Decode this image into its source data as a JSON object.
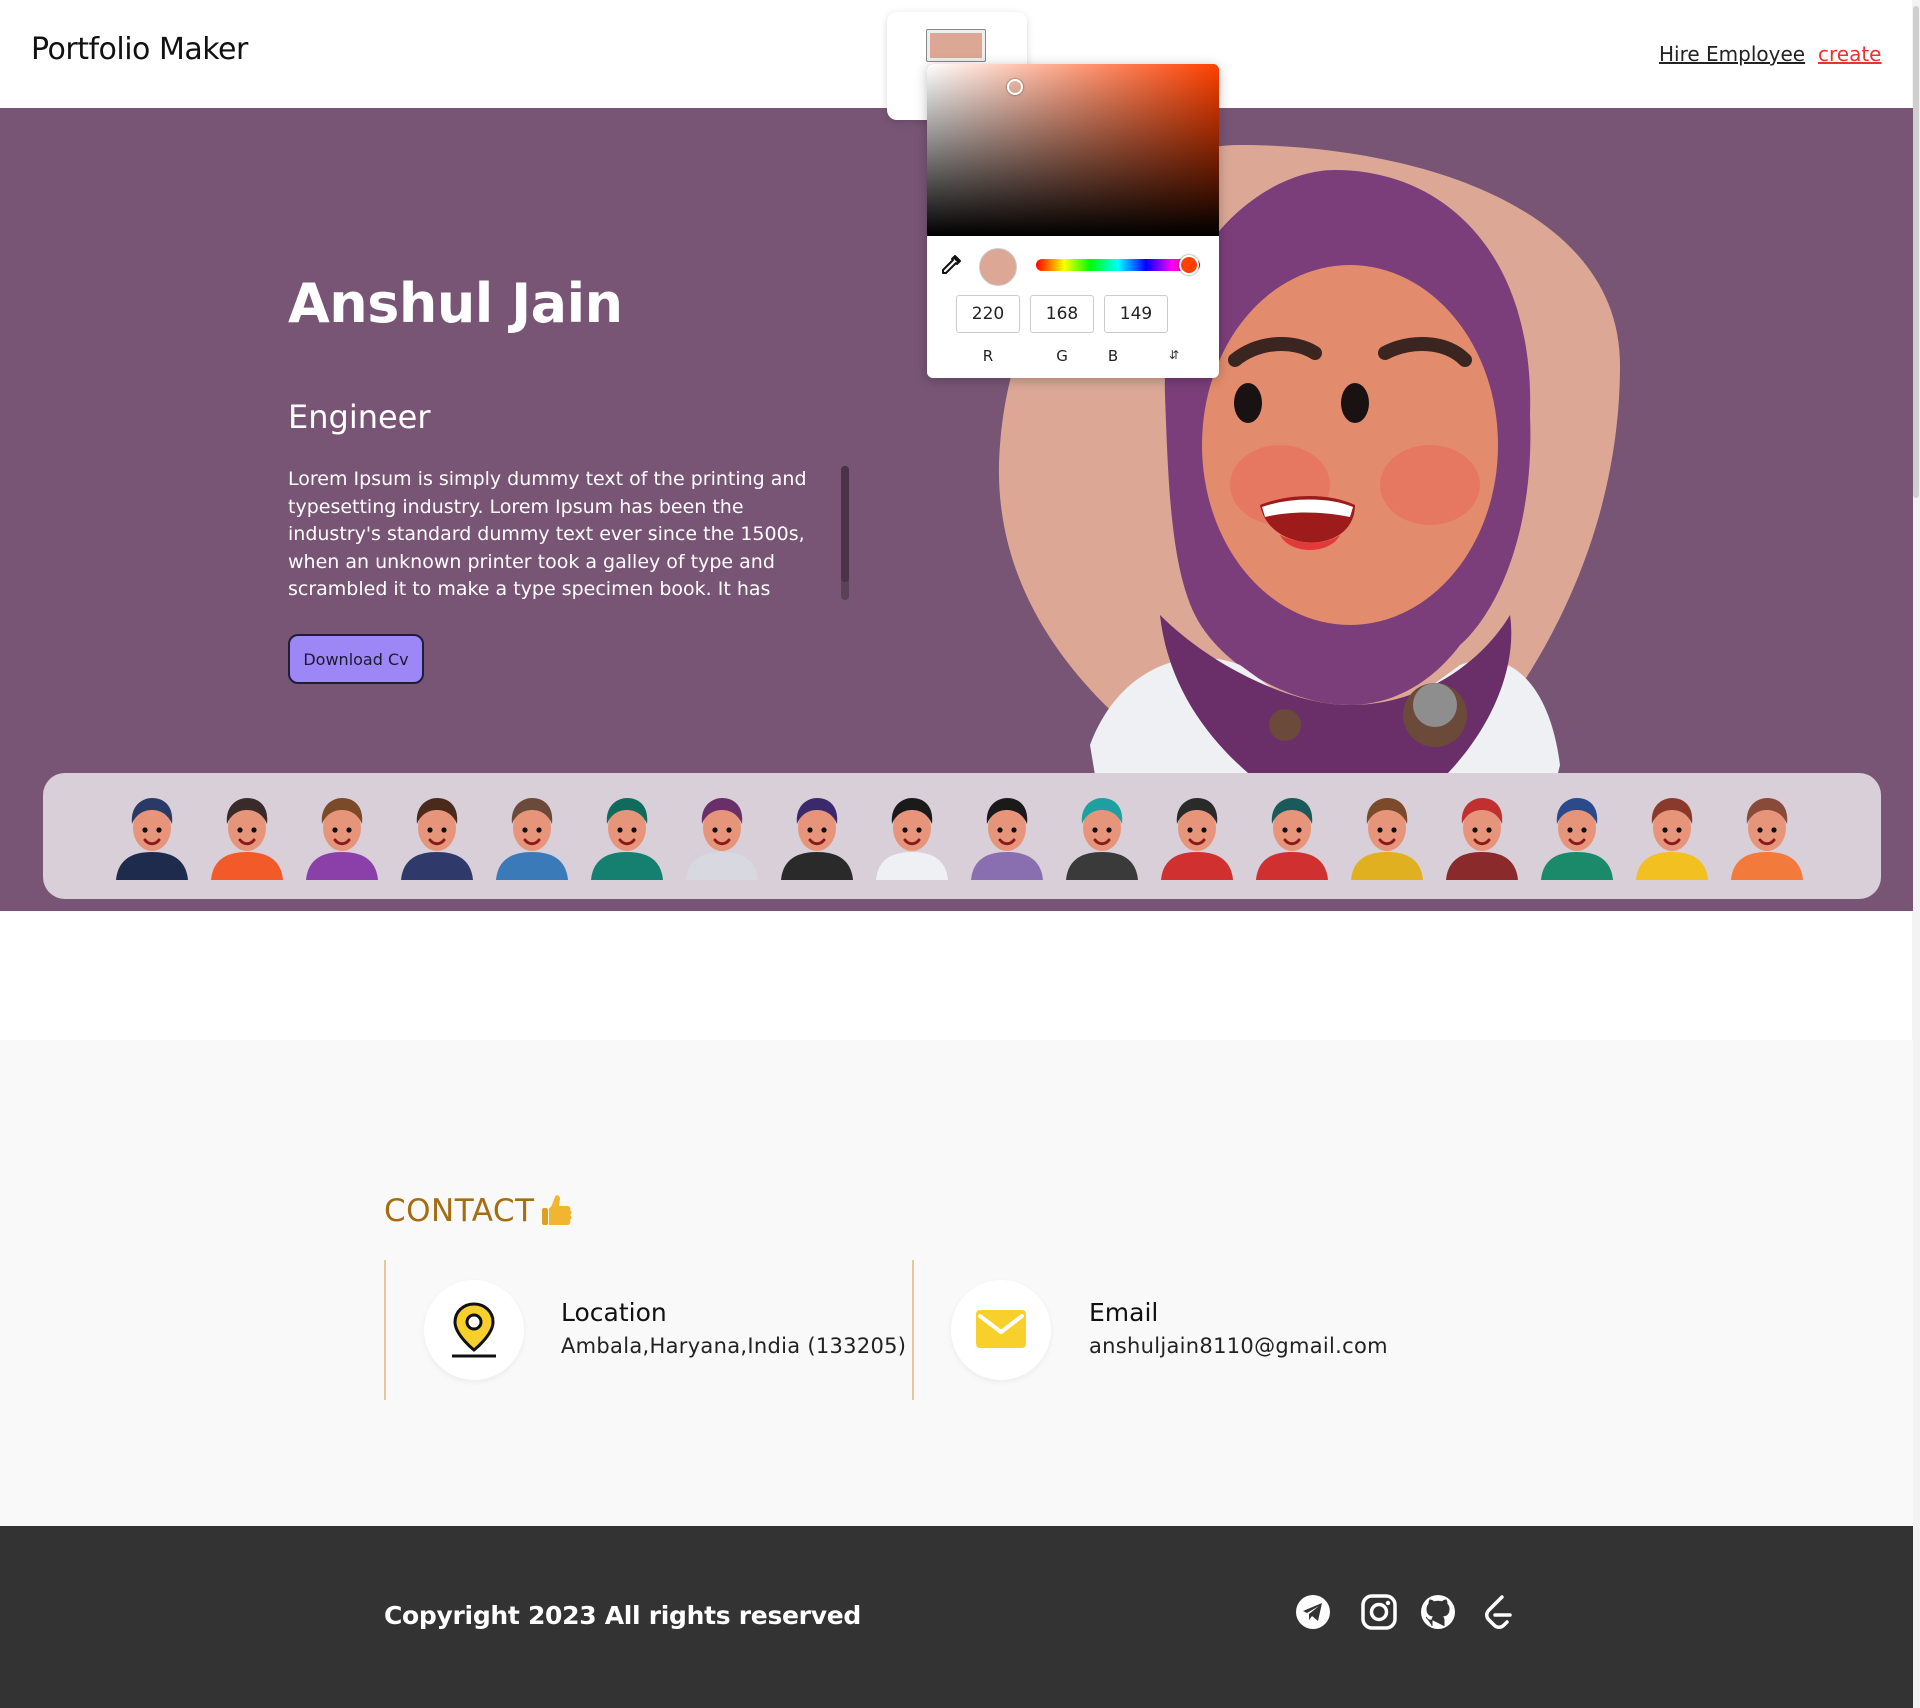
{
  "header": {
    "brand": "Portfolio Maker",
    "nav": {
      "hire": "Hire Employee",
      "create": "create"
    }
  },
  "hero": {
    "name": "Anshul Jain",
    "role": "Engineer",
    "description": "Lorem Ipsum is simply dummy text of the printing and typesetting industry. Lorem Ipsum has been the industry's standard dummy text ever since the 1500s, when an unknown printer took a galley of type and scrambled it to make a type specimen book. It has survived not only five",
    "download_button": "Download Cv",
    "background_color": "#785575",
    "blob_color": "#dca895"
  },
  "avatar_strip": {
    "avatars": [
      "graduate",
      "woman-black-hair",
      "woman-brown-hair",
      "bearded-man-glasses",
      "artist",
      "surgeon",
      "hijab-doctor",
      "developer",
      "male-doctor",
      "woman-long-hair",
      "teal-hair-man",
      "bearded-beanie-man",
      "headset-gamer",
      "student-backpack",
      "cap-man",
      "blue-hair-man",
      "curly-hair-glasses",
      "woman-backpack"
    ]
  },
  "color_picker": {
    "selected_color": "#dca895",
    "r": "220",
    "g": "168",
    "b": "149",
    "labels": {
      "r": "R",
      "g": "G",
      "b": "B"
    },
    "hue_color": "#ff4000"
  },
  "contact": {
    "title": "CONTACT",
    "location": {
      "label": "Location",
      "value": "Ambala,Haryana,India (133205)"
    },
    "email": {
      "label": "Email",
      "value": "anshuljain8110@gmail.com"
    },
    "accent_color": "#a46d12"
  },
  "footer": {
    "copyright": "Copyright 2023 All rights reserved",
    "social": [
      "telegram-icon",
      "instagram-icon",
      "github-icon",
      "leetcode-icon"
    ]
  }
}
